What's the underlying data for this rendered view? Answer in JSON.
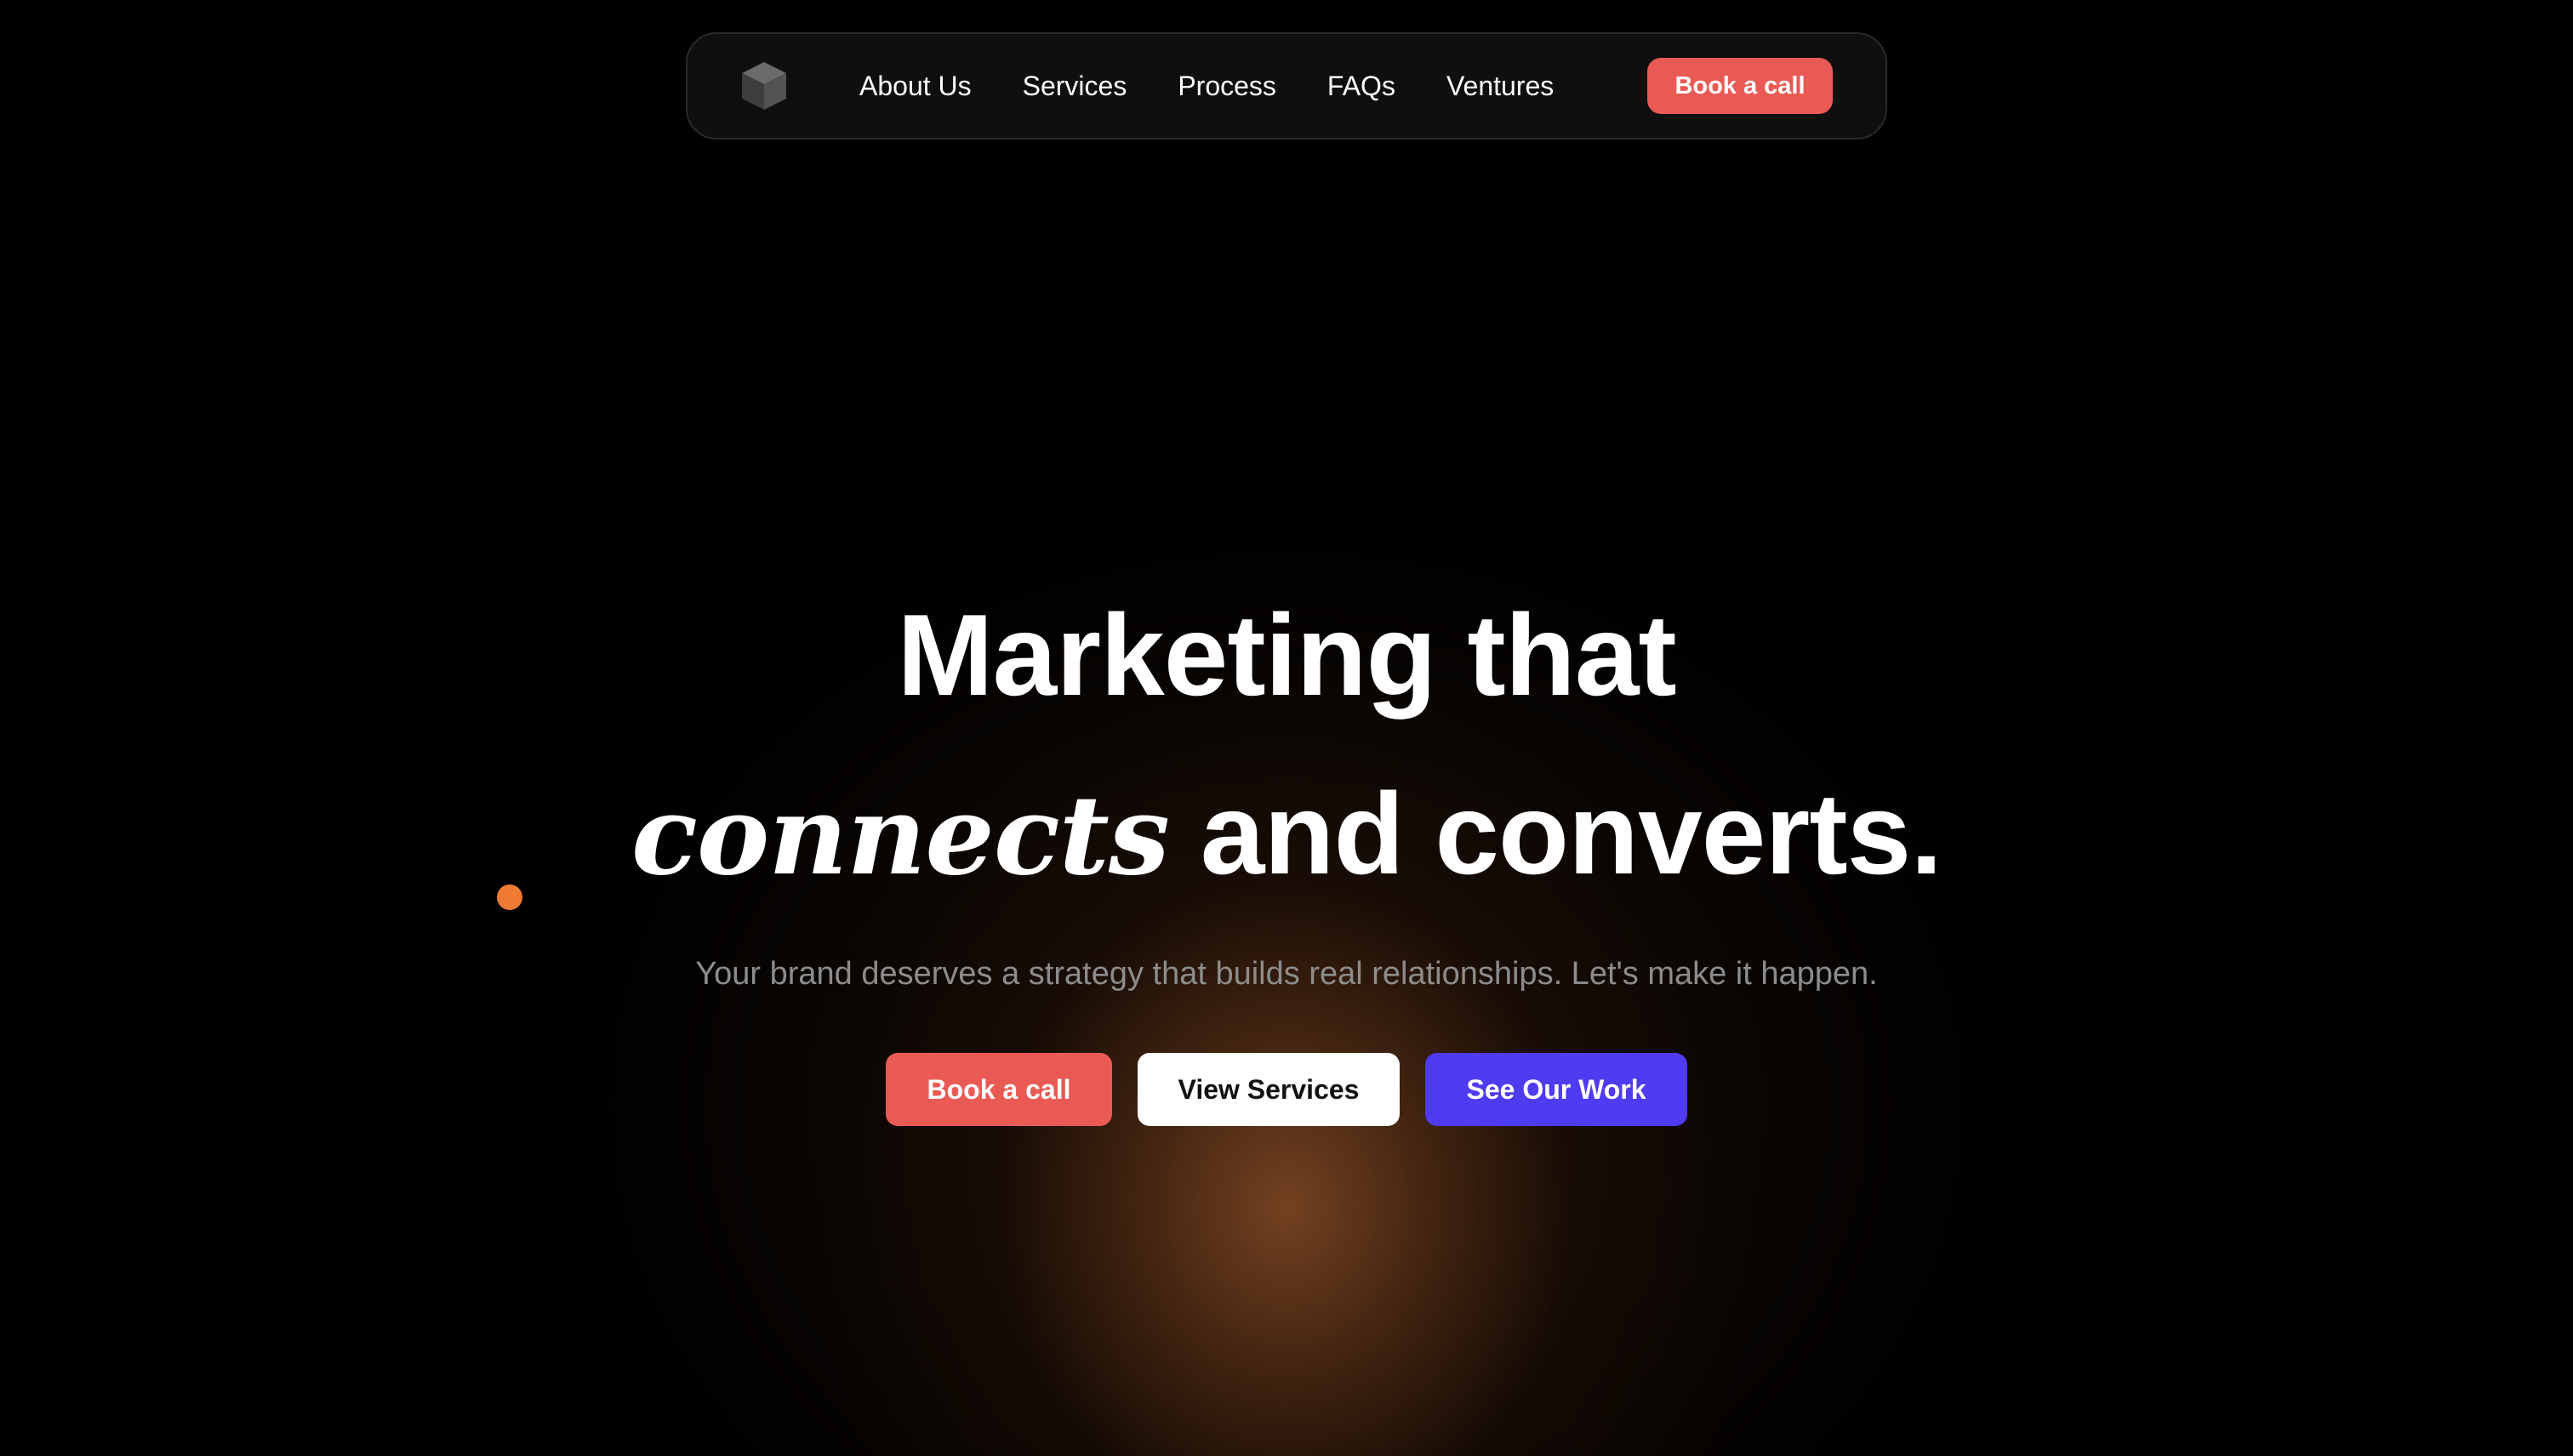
{
  "nav": {
    "logo_icon": "cube-icon",
    "links": [
      "About Us",
      "Services",
      "Process",
      "FAQs",
      "Ventures"
    ],
    "cta_label": "Book a call",
    "cta_color": "#ea5a55"
  },
  "hero": {
    "title_line1": "Marketing that",
    "title_line2_italic": "connects",
    "title_line2_rest": " and converts.",
    "subtitle": "Your brand deserves a strategy that builds real relationships. Let's make it happen.",
    "buttons": {
      "book": "Book a call",
      "services": "View Services",
      "work": "See Our Work"
    }
  },
  "colors": {
    "accent_red": "#ea5a55",
    "accent_purple": "#4f3bf2",
    "dot_orange": "#f07a33",
    "glow": "#783f1c"
  }
}
